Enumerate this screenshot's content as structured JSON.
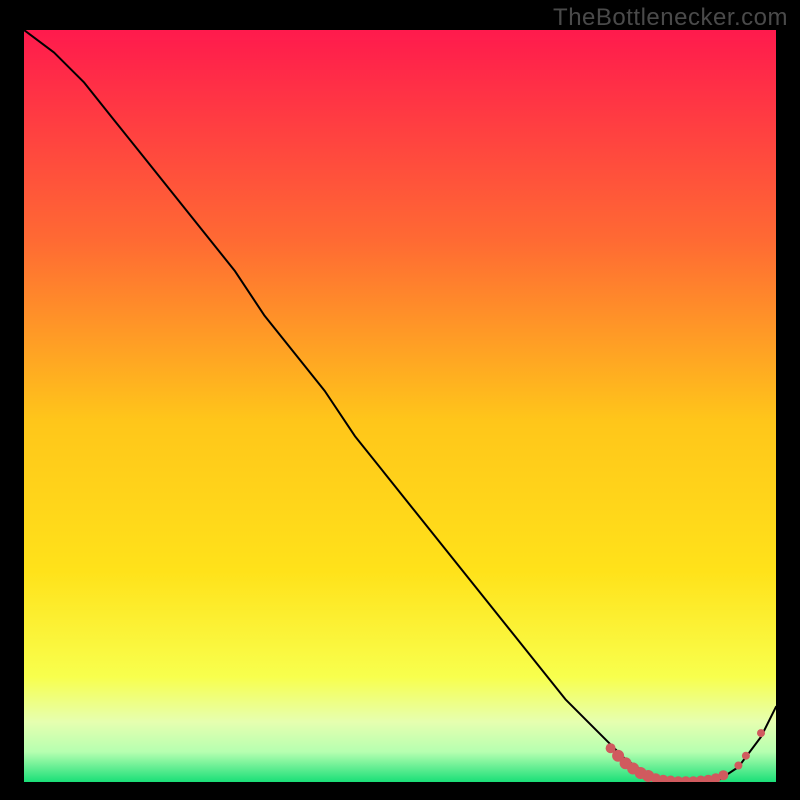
{
  "watermark": "TheBottlenecker.com",
  "chart_data": {
    "type": "line",
    "title": "",
    "xlabel": "",
    "ylabel": "",
    "xlim": [
      0,
      100
    ],
    "ylim": [
      0,
      100
    ],
    "background_gradient": {
      "top": "#ff1a4d",
      "mid_upper": "#ff8a2b",
      "mid": "#ffe21a",
      "mid_lower": "#f5ff66",
      "band": "#e6ffb0",
      "bottom": "#1adf78"
    },
    "series": [
      {
        "name": "bottleneck-curve",
        "x": [
          0,
          4,
          8,
          12,
          16,
          20,
          24,
          28,
          32,
          36,
          40,
          44,
          48,
          52,
          56,
          60,
          64,
          68,
          72,
          76,
          80,
          83,
          86,
          89,
          92,
          95,
          98,
          100
        ],
        "y": [
          100,
          97,
          93,
          88,
          83,
          78,
          73,
          68,
          62,
          57,
          52,
          46,
          41,
          36,
          31,
          26,
          21,
          16,
          11,
          7,
          3,
          1,
          0,
          0,
          0,
          2,
          6,
          10
        ]
      }
    ],
    "markers": {
      "name": "highlight-dots",
      "color": "#d05a5e",
      "points": [
        {
          "x": 78,
          "y": 4.5,
          "r": 5
        },
        {
          "x": 79,
          "y": 3.5,
          "r": 6
        },
        {
          "x": 80,
          "y": 2.5,
          "r": 6
        },
        {
          "x": 81,
          "y": 1.8,
          "r": 6
        },
        {
          "x": 82,
          "y": 1.2,
          "r": 6
        },
        {
          "x": 83,
          "y": 0.8,
          "r": 6
        },
        {
          "x": 84,
          "y": 0.5,
          "r": 5
        },
        {
          "x": 85,
          "y": 0.3,
          "r": 5
        },
        {
          "x": 86,
          "y": 0.2,
          "r": 5
        },
        {
          "x": 87,
          "y": 0.1,
          "r": 5
        },
        {
          "x": 88,
          "y": 0.1,
          "r": 5
        },
        {
          "x": 89,
          "y": 0.1,
          "r": 5
        },
        {
          "x": 90,
          "y": 0.2,
          "r": 5
        },
        {
          "x": 91,
          "y": 0.3,
          "r": 5
        },
        {
          "x": 92,
          "y": 0.5,
          "r": 5
        },
        {
          "x": 93,
          "y": 0.9,
          "r": 5
        },
        {
          "x": 95,
          "y": 2.2,
          "r": 4
        },
        {
          "x": 96,
          "y": 3.5,
          "r": 4
        },
        {
          "x": 98,
          "y": 6.5,
          "r": 4
        }
      ]
    }
  }
}
